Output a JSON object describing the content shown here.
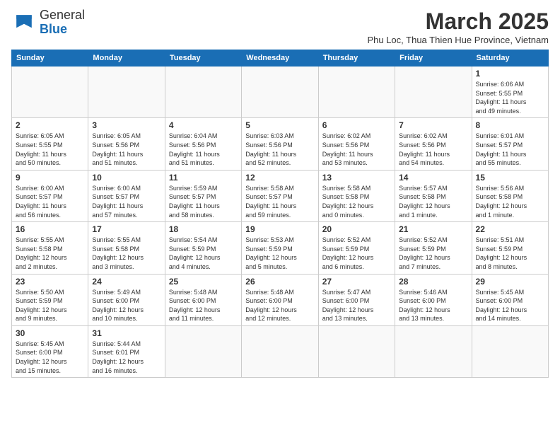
{
  "header": {
    "logo_general": "General",
    "logo_blue": "Blue",
    "month_title": "March 2025",
    "location": "Phu Loc, Thua Thien Hue Province, Vietnam"
  },
  "days_of_week": [
    "Sunday",
    "Monday",
    "Tuesday",
    "Wednesday",
    "Thursday",
    "Friday",
    "Saturday"
  ],
  "weeks": [
    [
      {
        "day": "",
        "info": ""
      },
      {
        "day": "",
        "info": ""
      },
      {
        "day": "",
        "info": ""
      },
      {
        "day": "",
        "info": ""
      },
      {
        "day": "",
        "info": ""
      },
      {
        "day": "",
        "info": ""
      },
      {
        "day": "1",
        "info": "Sunrise: 6:06 AM\nSunset: 5:55 PM\nDaylight: 11 hours\nand 49 minutes."
      }
    ],
    [
      {
        "day": "2",
        "info": "Sunrise: 6:05 AM\nSunset: 5:55 PM\nDaylight: 11 hours\nand 50 minutes."
      },
      {
        "day": "3",
        "info": "Sunrise: 6:05 AM\nSunset: 5:56 PM\nDaylight: 11 hours\nand 51 minutes."
      },
      {
        "day": "4",
        "info": "Sunrise: 6:04 AM\nSunset: 5:56 PM\nDaylight: 11 hours\nand 51 minutes."
      },
      {
        "day": "5",
        "info": "Sunrise: 6:03 AM\nSunset: 5:56 PM\nDaylight: 11 hours\nand 52 minutes."
      },
      {
        "day": "6",
        "info": "Sunrise: 6:02 AM\nSunset: 5:56 PM\nDaylight: 11 hours\nand 53 minutes."
      },
      {
        "day": "7",
        "info": "Sunrise: 6:02 AM\nSunset: 5:56 PM\nDaylight: 11 hours\nand 54 minutes."
      },
      {
        "day": "8",
        "info": "Sunrise: 6:01 AM\nSunset: 5:57 PM\nDaylight: 11 hours\nand 55 minutes."
      }
    ],
    [
      {
        "day": "9",
        "info": "Sunrise: 6:00 AM\nSunset: 5:57 PM\nDaylight: 11 hours\nand 56 minutes."
      },
      {
        "day": "10",
        "info": "Sunrise: 6:00 AM\nSunset: 5:57 PM\nDaylight: 11 hours\nand 57 minutes."
      },
      {
        "day": "11",
        "info": "Sunrise: 5:59 AM\nSunset: 5:57 PM\nDaylight: 11 hours\nand 58 minutes."
      },
      {
        "day": "12",
        "info": "Sunrise: 5:58 AM\nSunset: 5:57 PM\nDaylight: 11 hours\nand 59 minutes."
      },
      {
        "day": "13",
        "info": "Sunrise: 5:58 AM\nSunset: 5:58 PM\nDaylight: 12 hours\nand 0 minutes."
      },
      {
        "day": "14",
        "info": "Sunrise: 5:57 AM\nSunset: 5:58 PM\nDaylight: 12 hours\nand 1 minute."
      },
      {
        "day": "15",
        "info": "Sunrise: 5:56 AM\nSunset: 5:58 PM\nDaylight: 12 hours\nand 1 minute."
      }
    ],
    [
      {
        "day": "16",
        "info": "Sunrise: 5:55 AM\nSunset: 5:58 PM\nDaylight: 12 hours\nand 2 minutes."
      },
      {
        "day": "17",
        "info": "Sunrise: 5:55 AM\nSunset: 5:58 PM\nDaylight: 12 hours\nand 3 minutes."
      },
      {
        "day": "18",
        "info": "Sunrise: 5:54 AM\nSunset: 5:59 PM\nDaylight: 12 hours\nand 4 minutes."
      },
      {
        "day": "19",
        "info": "Sunrise: 5:53 AM\nSunset: 5:59 PM\nDaylight: 12 hours\nand 5 minutes."
      },
      {
        "day": "20",
        "info": "Sunrise: 5:52 AM\nSunset: 5:59 PM\nDaylight: 12 hours\nand 6 minutes."
      },
      {
        "day": "21",
        "info": "Sunrise: 5:52 AM\nSunset: 5:59 PM\nDaylight: 12 hours\nand 7 minutes."
      },
      {
        "day": "22",
        "info": "Sunrise: 5:51 AM\nSunset: 5:59 PM\nDaylight: 12 hours\nand 8 minutes."
      }
    ],
    [
      {
        "day": "23",
        "info": "Sunrise: 5:50 AM\nSunset: 5:59 PM\nDaylight: 12 hours\nand 9 minutes."
      },
      {
        "day": "24",
        "info": "Sunrise: 5:49 AM\nSunset: 6:00 PM\nDaylight: 12 hours\nand 10 minutes."
      },
      {
        "day": "25",
        "info": "Sunrise: 5:48 AM\nSunset: 6:00 PM\nDaylight: 12 hours\nand 11 minutes."
      },
      {
        "day": "26",
        "info": "Sunrise: 5:48 AM\nSunset: 6:00 PM\nDaylight: 12 hours\nand 12 minutes."
      },
      {
        "day": "27",
        "info": "Sunrise: 5:47 AM\nSunset: 6:00 PM\nDaylight: 12 hours\nand 13 minutes."
      },
      {
        "day": "28",
        "info": "Sunrise: 5:46 AM\nSunset: 6:00 PM\nDaylight: 12 hours\nand 13 minutes."
      },
      {
        "day": "29",
        "info": "Sunrise: 5:45 AM\nSunset: 6:00 PM\nDaylight: 12 hours\nand 14 minutes."
      }
    ],
    [
      {
        "day": "30",
        "info": "Sunrise: 5:45 AM\nSunset: 6:00 PM\nDaylight: 12 hours\nand 15 minutes."
      },
      {
        "day": "31",
        "info": "Sunrise: 5:44 AM\nSunset: 6:01 PM\nDaylight: 12 hours\nand 16 minutes."
      },
      {
        "day": "",
        "info": ""
      },
      {
        "day": "",
        "info": ""
      },
      {
        "day": "",
        "info": ""
      },
      {
        "day": "",
        "info": ""
      },
      {
        "day": "",
        "info": ""
      }
    ]
  ]
}
